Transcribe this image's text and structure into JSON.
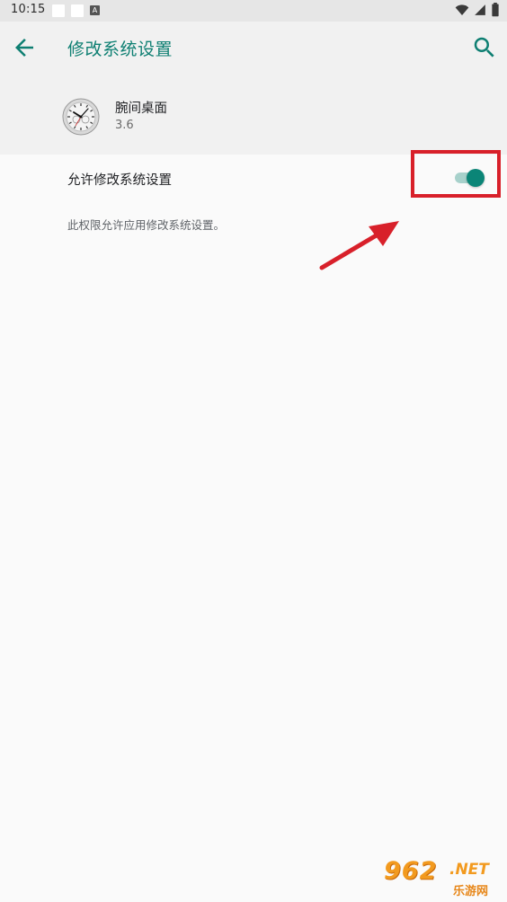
{
  "status_bar": {
    "time": "10:15",
    "notif_icon": "A"
  },
  "app_bar": {
    "title": "修改系统设置",
    "back_icon": "arrow-left-icon",
    "search_icon": "search-icon",
    "accent_color": "#0e7f72"
  },
  "app_info": {
    "name": "腕间桌面",
    "version": "3.6",
    "icon": "watch-face-icon"
  },
  "setting": {
    "label": "允许修改系统设置",
    "enabled": true,
    "description": "此权限允许应用修改系统设置。",
    "toggle_color": "#0b8577"
  },
  "annotation": {
    "highlight_color": "#d8202a"
  },
  "watermark": {
    "logo": "962",
    "domain": ".NET",
    "sub": "乐游网"
  }
}
